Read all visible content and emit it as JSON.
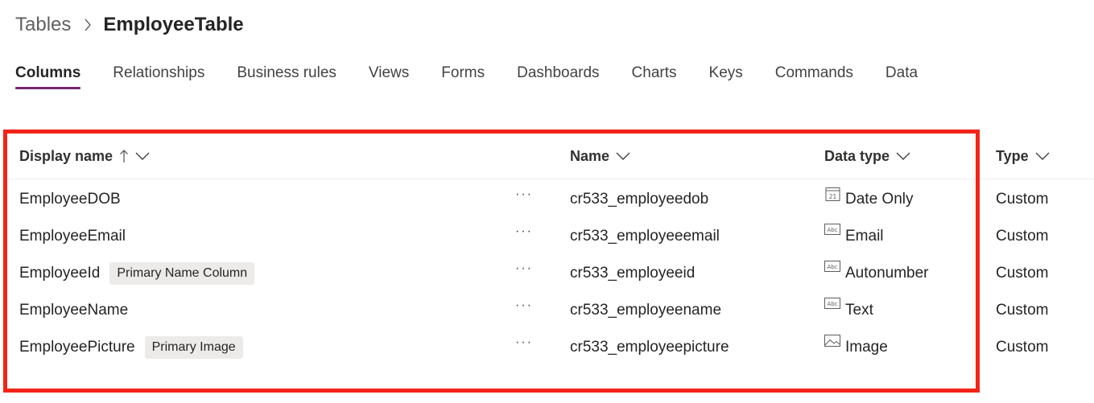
{
  "breadcrumb": {
    "root": "Tables",
    "current": "EmployeeTable"
  },
  "tabs": [
    {
      "label": "Columns",
      "active": true
    },
    {
      "label": "Relationships",
      "active": false
    },
    {
      "label": "Business rules",
      "active": false
    },
    {
      "label": "Views",
      "active": false
    },
    {
      "label": "Forms",
      "active": false
    },
    {
      "label": "Dashboards",
      "active": false
    },
    {
      "label": "Charts",
      "active": false
    },
    {
      "label": "Keys",
      "active": false
    },
    {
      "label": "Commands",
      "active": false
    },
    {
      "label": "Data",
      "active": false
    }
  ],
  "table": {
    "headers": {
      "display_name": "Display name",
      "display_name_sort": "ascending",
      "name": "Name",
      "data_type": "Data type",
      "type": "Type"
    },
    "rows": [
      {
        "display_name": "EmployeeDOB",
        "badge": "",
        "more": "···",
        "name": "cr533_employeedob",
        "data_type": "Date Only",
        "data_type_icon": "calendar-icon",
        "type": "Custom"
      },
      {
        "display_name": "EmployeeEmail",
        "badge": "",
        "more": "···",
        "name": "cr533_employeeemail",
        "data_type": "Email",
        "data_type_icon": "text-abc-icon",
        "type": "Custom"
      },
      {
        "display_name": "EmployeeId",
        "badge": "Primary Name Column",
        "more": "···",
        "name": "cr533_employeeid",
        "data_type": "Autonumber",
        "data_type_icon": "text-abc-icon",
        "type": "Custom"
      },
      {
        "display_name": "EmployeeName",
        "badge": "",
        "more": "···",
        "name": "cr533_employeename",
        "data_type": "Text",
        "data_type_icon": "text-abc-icon",
        "type": "Custom"
      },
      {
        "display_name": "EmployeePicture",
        "badge": "Primary Image",
        "more": "···",
        "name": "cr533_employeepicture",
        "data_type": "Image",
        "data_type_icon": "image-icon",
        "type": "Custom"
      }
    ]
  },
  "colors": {
    "accent": "#742774",
    "highlight_border": "#f22418",
    "badge_bg": "#edebe9"
  }
}
